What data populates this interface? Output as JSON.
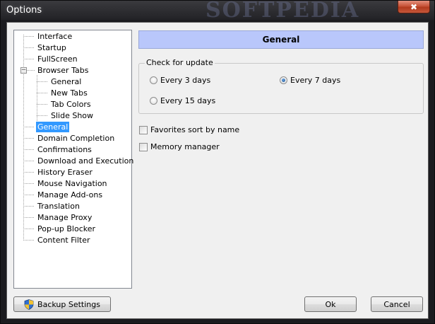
{
  "window": {
    "title": "Options",
    "watermark": "SOFTPEDIA",
    "close_glyph": "✖"
  },
  "tree": {
    "items": [
      {
        "label": "Interface",
        "level": 0
      },
      {
        "label": "Startup",
        "level": 0
      },
      {
        "label": "FullScreen",
        "level": 0
      },
      {
        "label": "Browser Tabs",
        "level": 0,
        "expanded": true,
        "expander": "−"
      },
      {
        "label": "General",
        "level": 1
      },
      {
        "label": "New Tabs",
        "level": 1
      },
      {
        "label": "Tab Colors",
        "level": 1
      },
      {
        "label": "Slide Show",
        "level": 1
      },
      {
        "label": "General",
        "level": 0,
        "selected": true
      },
      {
        "label": "Domain Completion",
        "level": 0
      },
      {
        "label": "Confirmations",
        "level": 0
      },
      {
        "label": "Download and Execution",
        "level": 0
      },
      {
        "label": "History Eraser",
        "level": 0
      },
      {
        "label": "Mouse Navigation",
        "level": 0
      },
      {
        "label": "Manage Add-ons",
        "level": 0
      },
      {
        "label": "Translation",
        "level": 0
      },
      {
        "label": "Manage Proxy",
        "level": 0
      },
      {
        "label": "Pop-up Blocker",
        "level": 0
      },
      {
        "label": "Content Filter",
        "level": 0
      }
    ]
  },
  "panel": {
    "header": "General",
    "update_group": {
      "legend": "Check for update",
      "options": [
        {
          "label": "Every 3 days",
          "checked": false
        },
        {
          "label": "Every 7 days",
          "checked": true
        },
        {
          "label": "Every 15 days",
          "checked": false
        }
      ]
    },
    "checkboxes": [
      {
        "label": "Favorites sort by name",
        "checked": false
      },
      {
        "label": "Memory manager",
        "checked": false
      }
    ]
  },
  "buttons": {
    "backup": "Backup Settings",
    "ok": "Ok",
    "cancel": "Cancel"
  },
  "colors": {
    "header_bg": "#b9c7fb",
    "selection": "#3399ff",
    "close_button": "#c75338"
  }
}
